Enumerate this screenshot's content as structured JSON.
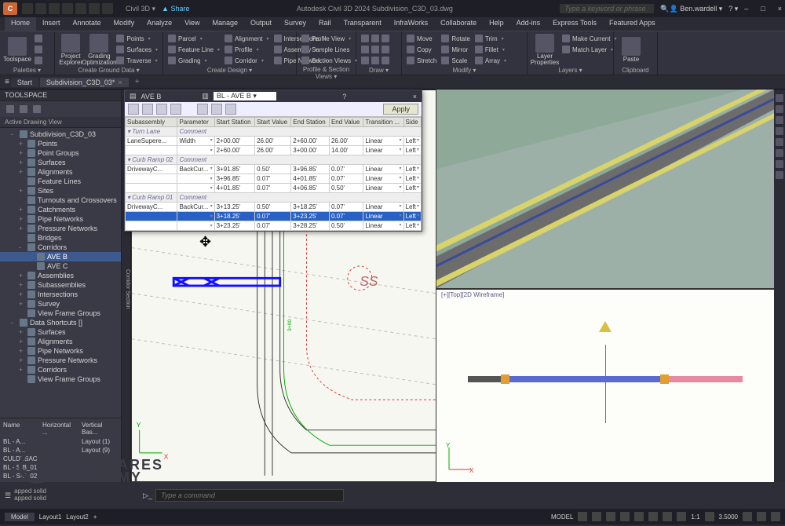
{
  "titlebar": {
    "app_letter": "C",
    "app_name_drop": "Civil 3D",
    "share": "Share",
    "title_center": "Autodesk Civil 3D 2024   Subdivision_C3D_03.dwg",
    "search_placeholder": "Type a keyword or phrase",
    "user": "Ben.wardell",
    "win_min": "–",
    "win_max": "□",
    "win_close": "×"
  },
  "ribbon_tabs": [
    "Home",
    "Insert",
    "Annotate",
    "Modify",
    "Analyze",
    "View",
    "Manage",
    "Output",
    "Survey",
    "Rail",
    "Transparent",
    "InfraWorks",
    "Collaborate",
    "Help",
    "Add-ins",
    "Express Tools",
    "Featured Apps"
  ],
  "ribbon_panels": {
    "palettes": {
      "label": "Palettes ▾",
      "big": "Toolspace"
    },
    "createground": {
      "label": "Create Ground Data ▾",
      "big1": "Project\nExplorer",
      "big2": "Grading\nOptimization",
      "col": [
        "Points ▾",
        "Surfaces ▾",
        "Traverse ▾"
      ]
    },
    "createdesign": {
      "label": "Create Design ▾",
      "cols": [
        [
          "Parcel ▾",
          "Feature Line ▾",
          "Grading ▾"
        ],
        [
          "Alignment ▾",
          "Profile ▾",
          "Corridor ▾"
        ],
        [
          "Intersections ▾",
          "Assembly ▾",
          "Pipe Network ▾"
        ]
      ]
    },
    "profilesection": {
      "label": "Profile & Section Views ▾",
      "cols": [
        [
          "Profile View ▾",
          "Sample Lines",
          "Section Views ▾"
        ]
      ]
    },
    "draw": {
      "label": "Draw ▾"
    },
    "modify": {
      "label": "Modify ▾",
      "cols": [
        [
          "Move",
          "Copy",
          "Stretch"
        ],
        [
          "Rotate",
          "Mirror",
          "Scale"
        ],
        [
          "Trim ▾",
          "Fillet ▾",
          "Array ▾"
        ]
      ]
    },
    "layers": {
      "label": "Layers ▾",
      "big": "Layer\nProperties",
      "col": [
        "Make Current",
        "Match Layer"
      ]
    },
    "clipboard": {
      "label": "Clipboard",
      "big": "Paste"
    }
  },
  "filetabs": {
    "start": "Start",
    "active": "Subdivision_C3D_03*"
  },
  "toolspace": {
    "title": "TOOLSPACE",
    "active_view": "Active Drawing View",
    "tree": [
      {
        "l": 1,
        "t": "Subdivision_C3D_03",
        "tw": "-"
      },
      {
        "l": 2,
        "t": "Points",
        "tw": "+"
      },
      {
        "l": 2,
        "t": "Point Groups",
        "tw": "+"
      },
      {
        "l": 2,
        "t": "Surfaces",
        "tw": "+"
      },
      {
        "l": 2,
        "t": "Alignments",
        "tw": "+"
      },
      {
        "l": 2,
        "t": "Feature Lines",
        "tw": ""
      },
      {
        "l": 2,
        "t": "Sites",
        "tw": "+"
      },
      {
        "l": 2,
        "t": "Turnouts and Crossovers",
        "tw": ""
      },
      {
        "l": 2,
        "t": "Catchments",
        "tw": "+"
      },
      {
        "l": 2,
        "t": "Pipe Networks",
        "tw": "+"
      },
      {
        "l": 2,
        "t": "Pressure Networks",
        "tw": "+"
      },
      {
        "l": 2,
        "t": "Bridges",
        "tw": ""
      },
      {
        "l": 2,
        "t": "Corridors",
        "tw": "-"
      },
      {
        "l": 3,
        "t": "AVE B",
        "sel": true
      },
      {
        "l": 3,
        "t": "AVE C"
      },
      {
        "l": 2,
        "t": "Assemblies",
        "tw": "+"
      },
      {
        "l": 2,
        "t": "Subassemblies",
        "tw": "+"
      },
      {
        "l": 2,
        "t": "Intersections",
        "tw": "+"
      },
      {
        "l": 2,
        "t": "Survey",
        "tw": "+"
      },
      {
        "l": 2,
        "t": "View Frame Groups",
        "tw": ""
      },
      {
        "l": 1,
        "t": "Data Shortcuts []",
        "tw": "-"
      },
      {
        "l": 2,
        "t": "Surfaces",
        "tw": "+"
      },
      {
        "l": 2,
        "t": "Alignments",
        "tw": "+"
      },
      {
        "l": 2,
        "t": "Pipe Networks",
        "tw": "+"
      },
      {
        "l": 2,
        "t": "Pressure Networks",
        "tw": "+"
      },
      {
        "l": 2,
        "t": "Corridors",
        "tw": "+"
      },
      {
        "l": 2,
        "t": "View Frame Groups",
        "tw": ""
      }
    ],
    "grid_headers": [
      "Name",
      "Horizontal ...",
      "Vertical Bas..."
    ],
    "grid_rows": [
      [
        "BL - A...",
        "",
        "Layout (1)"
      ],
      [
        "BL - A...",
        "",
        "Layout (9)"
      ],
      [
        "CULDESAC",
        "",
        ""
      ],
      [
        "BL - S-B_01",
        "",
        ""
      ],
      [
        "BL - S-B_02",
        "",
        ""
      ]
    ]
  },
  "section_editor": {
    "title": "AVE B",
    "region": "BL - AVE B",
    "apply": "Apply",
    "columns": [
      "Subassembly",
      "Parameter",
      "Start Station",
      "Start Value",
      "End Station",
      "End Value",
      "Transition ...",
      "Side"
    ],
    "groups": [
      {
        "name": "Turn Lane",
        "comment": "Comment",
        "rows": [
          [
            "LaneSupere...",
            "Width",
            "2+00.00'",
            "26.00'",
            "2+60.00'",
            "26.00'",
            "Linear",
            "Left"
          ],
          [
            "",
            "",
            "2+60.00'",
            "26.00'",
            "3+00.00'",
            "14.00'",
            "Linear",
            "Left"
          ]
        ]
      },
      {
        "name": "Curb Ramp 02",
        "comment": "Comment",
        "rows": [
          [
            "DrivewayC...",
            "BackCur...",
            "3+91.85'",
            "0.50'",
            "3+96.85'",
            "0.07'",
            "Linear",
            "Left"
          ],
          [
            "",
            "",
            "3+96.85'",
            "0.07'",
            "4+01.85'",
            "0.07'",
            "Linear",
            "Left"
          ],
          [
            "",
            "",
            "4+01.85'",
            "0.07'",
            "4+06.85'",
            "0.50'",
            "Linear",
            "Left"
          ]
        ]
      },
      {
        "name": "Curb Ramp 01",
        "comment": "Comment",
        "rows": [
          [
            "DrivewayC...",
            "BackCur...",
            "3+13.25'",
            "0.50'",
            "3+18.25'",
            "0.07'",
            "Linear",
            "Left"
          ],
          [
            "",
            "",
            "3+18.25'",
            "0.07'",
            "3+23.25'",
            "0.07'",
            "Linear",
            "Left",
            "hl"
          ],
          [
            "",
            "",
            "3+23.25'",
            "0.07'",
            "3+28.25'",
            "0.50'",
            "Linear",
            "Left"
          ]
        ]
      }
    ]
  },
  "rbot_header": "[+][Top][2D Wireframe]",
  "cmd": {
    "log1": "apped solid",
    "log2": "apped solid",
    "placeholder": "Type a command"
  },
  "status": {
    "model": "Model",
    "layout1": "Layout1",
    "layout2": "Layout2",
    "model_r": "MODEL",
    "scale": "1:1",
    "zoom": "3.5000"
  },
  "watermark": {
    "l1": "SOFTWARES",
    "l2": "ACADEMY"
  }
}
